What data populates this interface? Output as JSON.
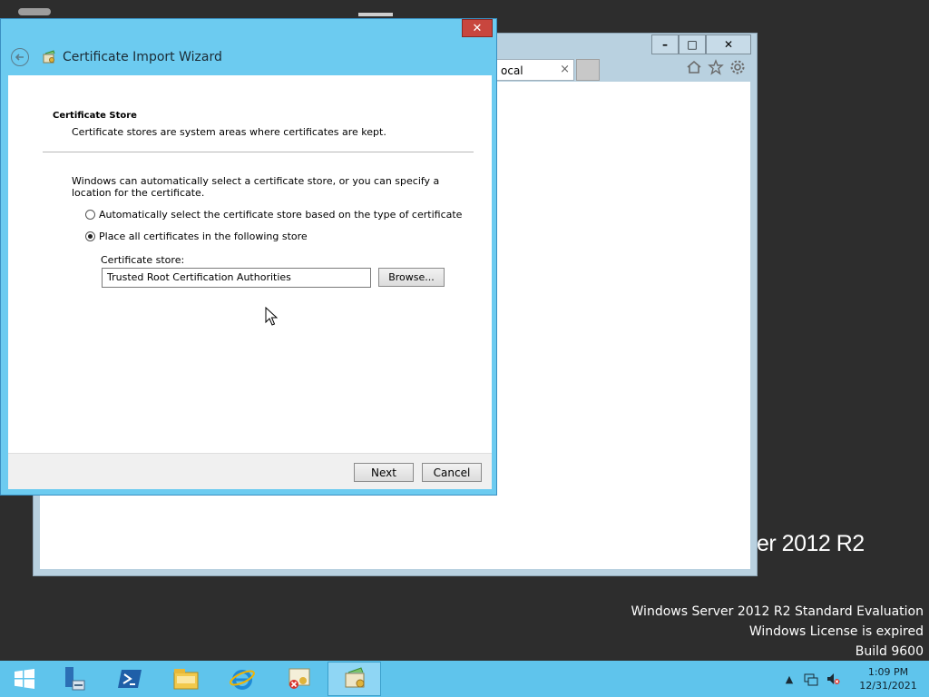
{
  "desktop": {
    "watermark_lines": [
      "Windows Server 2012 R2 Standard Evaluation",
      "Windows License is expired",
      "Build 9600"
    ],
    "brand_fragment": "er 2012 R2"
  },
  "ie_window": {
    "tab_label": "ocal",
    "tab_close": "×",
    "minimize": "–",
    "maximize": "□",
    "close": "✕",
    "icons": [
      "home-icon",
      "favorites-icon",
      "settings-icon"
    ]
  },
  "wizard": {
    "title": "Certificate Import Wizard",
    "close": "✕",
    "section_title": "Certificate Store",
    "section_desc": "Certificate stores are system areas where certificates are kept.",
    "intro": "Windows can automatically select a certificate store, or you can specify a location for the certificate.",
    "radio_auto": "Automatically select the certificate store based on the type of certificate",
    "radio_manual": "Place all certificates in the following store",
    "selected_option": "manual",
    "store_label": "Certificate store:",
    "store_value": "Trusted Root Certification Authorities",
    "browse_label": "Browse...",
    "next_label": "Next",
    "cancel_label": "Cancel"
  },
  "taskbar": {
    "items": [
      "start-icon",
      "server-manager-icon",
      "powershell-icon",
      "file-explorer-icon",
      "internet-explorer-icon",
      "certificate-icon",
      "certificate-import-icon"
    ],
    "active_item": "certificate-import-icon",
    "time": "1:09 PM",
    "date": "12/31/2021"
  }
}
